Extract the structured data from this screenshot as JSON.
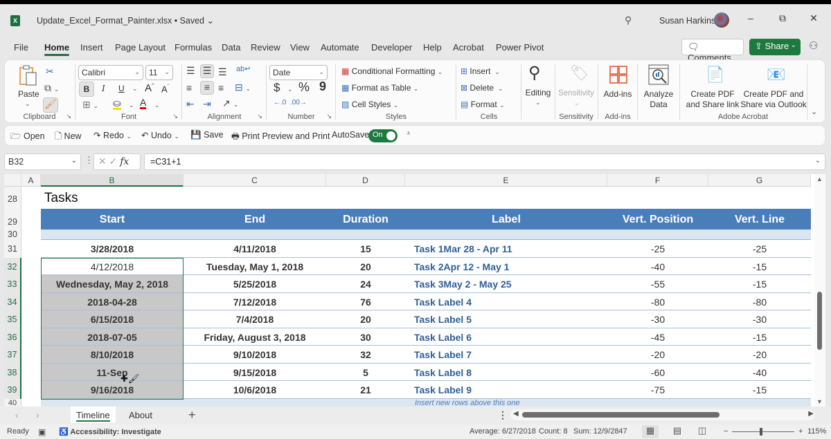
{
  "titlebar": {
    "app_icon": "excel-logo-icon",
    "document_title": "Update_Excel_Format_Painter.xlsx • Saved",
    "user_name": "Susan Harkins",
    "search_icon": "search-icon",
    "minimize": "–",
    "restore": "⧉",
    "close": "✕"
  },
  "menu": {
    "tabs": [
      "File",
      "Home",
      "Insert",
      "Page Layout",
      "Formulas",
      "Data",
      "Review",
      "View",
      "Automate",
      "Developer",
      "Help",
      "Acrobat",
      "Power Pivot"
    ],
    "active_tab": "Home",
    "comments_label": "Comments",
    "share_label": "Share"
  },
  "ribbon": {
    "clipboard": {
      "label": "Clipboard",
      "paste": "Paste"
    },
    "font": {
      "label": "Font",
      "font_name": "Calibri",
      "font_size": "11",
      "bold": "B",
      "italic": "I",
      "underline": "U",
      "grow": "A",
      "shrink": "A",
      "font_color": "A"
    },
    "alignment": {
      "label": "Alignment"
    },
    "number": {
      "label": "Number",
      "format": "Date",
      "currency": "$",
      "percent": "%",
      "comma": "9"
    },
    "styles": {
      "label": "Styles",
      "conditional": "Conditional Formatting",
      "format_table": "Format as Table",
      "cell_styles": "Cell Styles"
    },
    "cells": {
      "label": "Cells",
      "insert": "Insert",
      "delete": "Delete",
      "format": "Format"
    },
    "editing": {
      "label": "Editing"
    },
    "sensitivity": {
      "label": "Sensitivity",
      "button": "Sensitivity"
    },
    "addins": {
      "label": "Add-ins",
      "button": "Add-ins"
    },
    "analyze": {
      "line1": "Analyze",
      "line2": "Data"
    },
    "acrobat": {
      "label": "Adobe Acrobat",
      "pdf_share_1": "Create PDF",
      "pdf_share_2": "and Share link",
      "pdf_outlook_1": "Create PDF and",
      "pdf_outlook_2": "Share via Outlook"
    }
  },
  "qat": {
    "open": "Open",
    "new": "New",
    "redo": "Redo",
    "undo": "Undo",
    "save": "Save",
    "print": "Print Preview and Print",
    "autosave": "AutoSave",
    "autosave_state": "On"
  },
  "formula_bar": {
    "name_box": "B32",
    "fx": "fx",
    "formula": "=C31+1"
  },
  "grid": {
    "columns": [
      "A",
      "B",
      "C",
      "D",
      "E",
      "F",
      "G"
    ],
    "selected_column": "B",
    "rows": [
      "28",
      "29",
      "30",
      "31",
      "32",
      "33",
      "34",
      "35",
      "36",
      "37",
      "38",
      "39",
      "40"
    ],
    "sheet_title": "Tasks",
    "headers": [
      "Start",
      "End",
      "Duration",
      "Label",
      "Vert. Position",
      "Vert. Line"
    ],
    "data": [
      {
        "start": "3/28/2018",
        "end": "4/11/2018",
        "duration": "15",
        "label": "Task 1Mar 28 - Apr 11",
        "vpos": "-25",
        "vline": "-25"
      },
      {
        "start": "4/12/2018",
        "end": "Tuesday, May 1, 2018",
        "duration": "20",
        "label": "Task 2Apr 12 - May 1",
        "vpos": "-40",
        "vline": "-15"
      },
      {
        "start": "Wednesday, May 2, 2018",
        "end": "5/25/2018",
        "duration": "24",
        "label": "Task 3May 2 - May 25",
        "vpos": "-55",
        "vline": "-15"
      },
      {
        "start": "2018-04-28",
        "end": "7/12/2018",
        "duration": "76",
        "label": "Task Label 4",
        "vpos": "-80",
        "vline": "-80"
      },
      {
        "start": "6/15/2018",
        "end": "7/4/2018",
        "duration": "20",
        "label": "Task Label 5",
        "vpos": "-30",
        "vline": "-30"
      },
      {
        "start": "2018-07-05",
        "end": "Friday, August 3, 2018",
        "duration": "30",
        "label": "Task Label 6",
        "vpos": "-45",
        "vline": "-15"
      },
      {
        "start": "8/10/2018",
        "end": "9/10/2018",
        "duration": "32",
        "label": "Task Label 7",
        "vpos": "-20",
        "vline": "-20"
      },
      {
        "start": "11-Sep",
        "end": "9/15/2018",
        "duration": "5",
        "label": "Task Label 8",
        "vpos": "-60",
        "vline": "-40"
      },
      {
        "start": "9/16/2018",
        "end": "10/6/2018",
        "duration": "21",
        "label": "Task Label 9",
        "vpos": "-75",
        "vline": "-15"
      }
    ],
    "insert_note": "Insert new rows above this one"
  },
  "sheets": {
    "tabs": [
      "Timeline",
      "About"
    ],
    "active": "Timeline"
  },
  "status": {
    "ready": "Ready",
    "accessibility": "Accessibility: Investigate",
    "average": "Average: 6/27/2018",
    "count": "Count: 8",
    "sum": "Sum: 12/9/2847",
    "zoom_minus": "−",
    "zoom_plus": "+",
    "zoom_level": "115%"
  },
  "colors": {
    "excel_green": "#1d7a3e",
    "table_header": "#4a7ebb",
    "table_band": "#dce6f1",
    "label_text": "#2f5f98",
    "format_painted_fill": "#c8c8c8"
  }
}
